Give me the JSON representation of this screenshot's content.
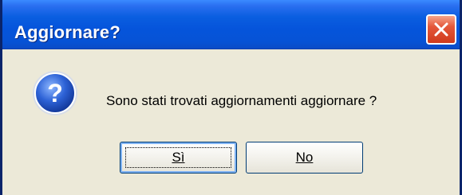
{
  "dialog": {
    "title": "Aggiornare?",
    "message": "Sono stati trovati aggiornamenti aggiornare ?",
    "icon": "question-icon",
    "buttons": {
      "yes_label": "Sì",
      "no_label": "No"
    }
  },
  "colors": {
    "titlebar": "#0554db",
    "background": "#ece9d8",
    "close_button": "#e4573a"
  }
}
